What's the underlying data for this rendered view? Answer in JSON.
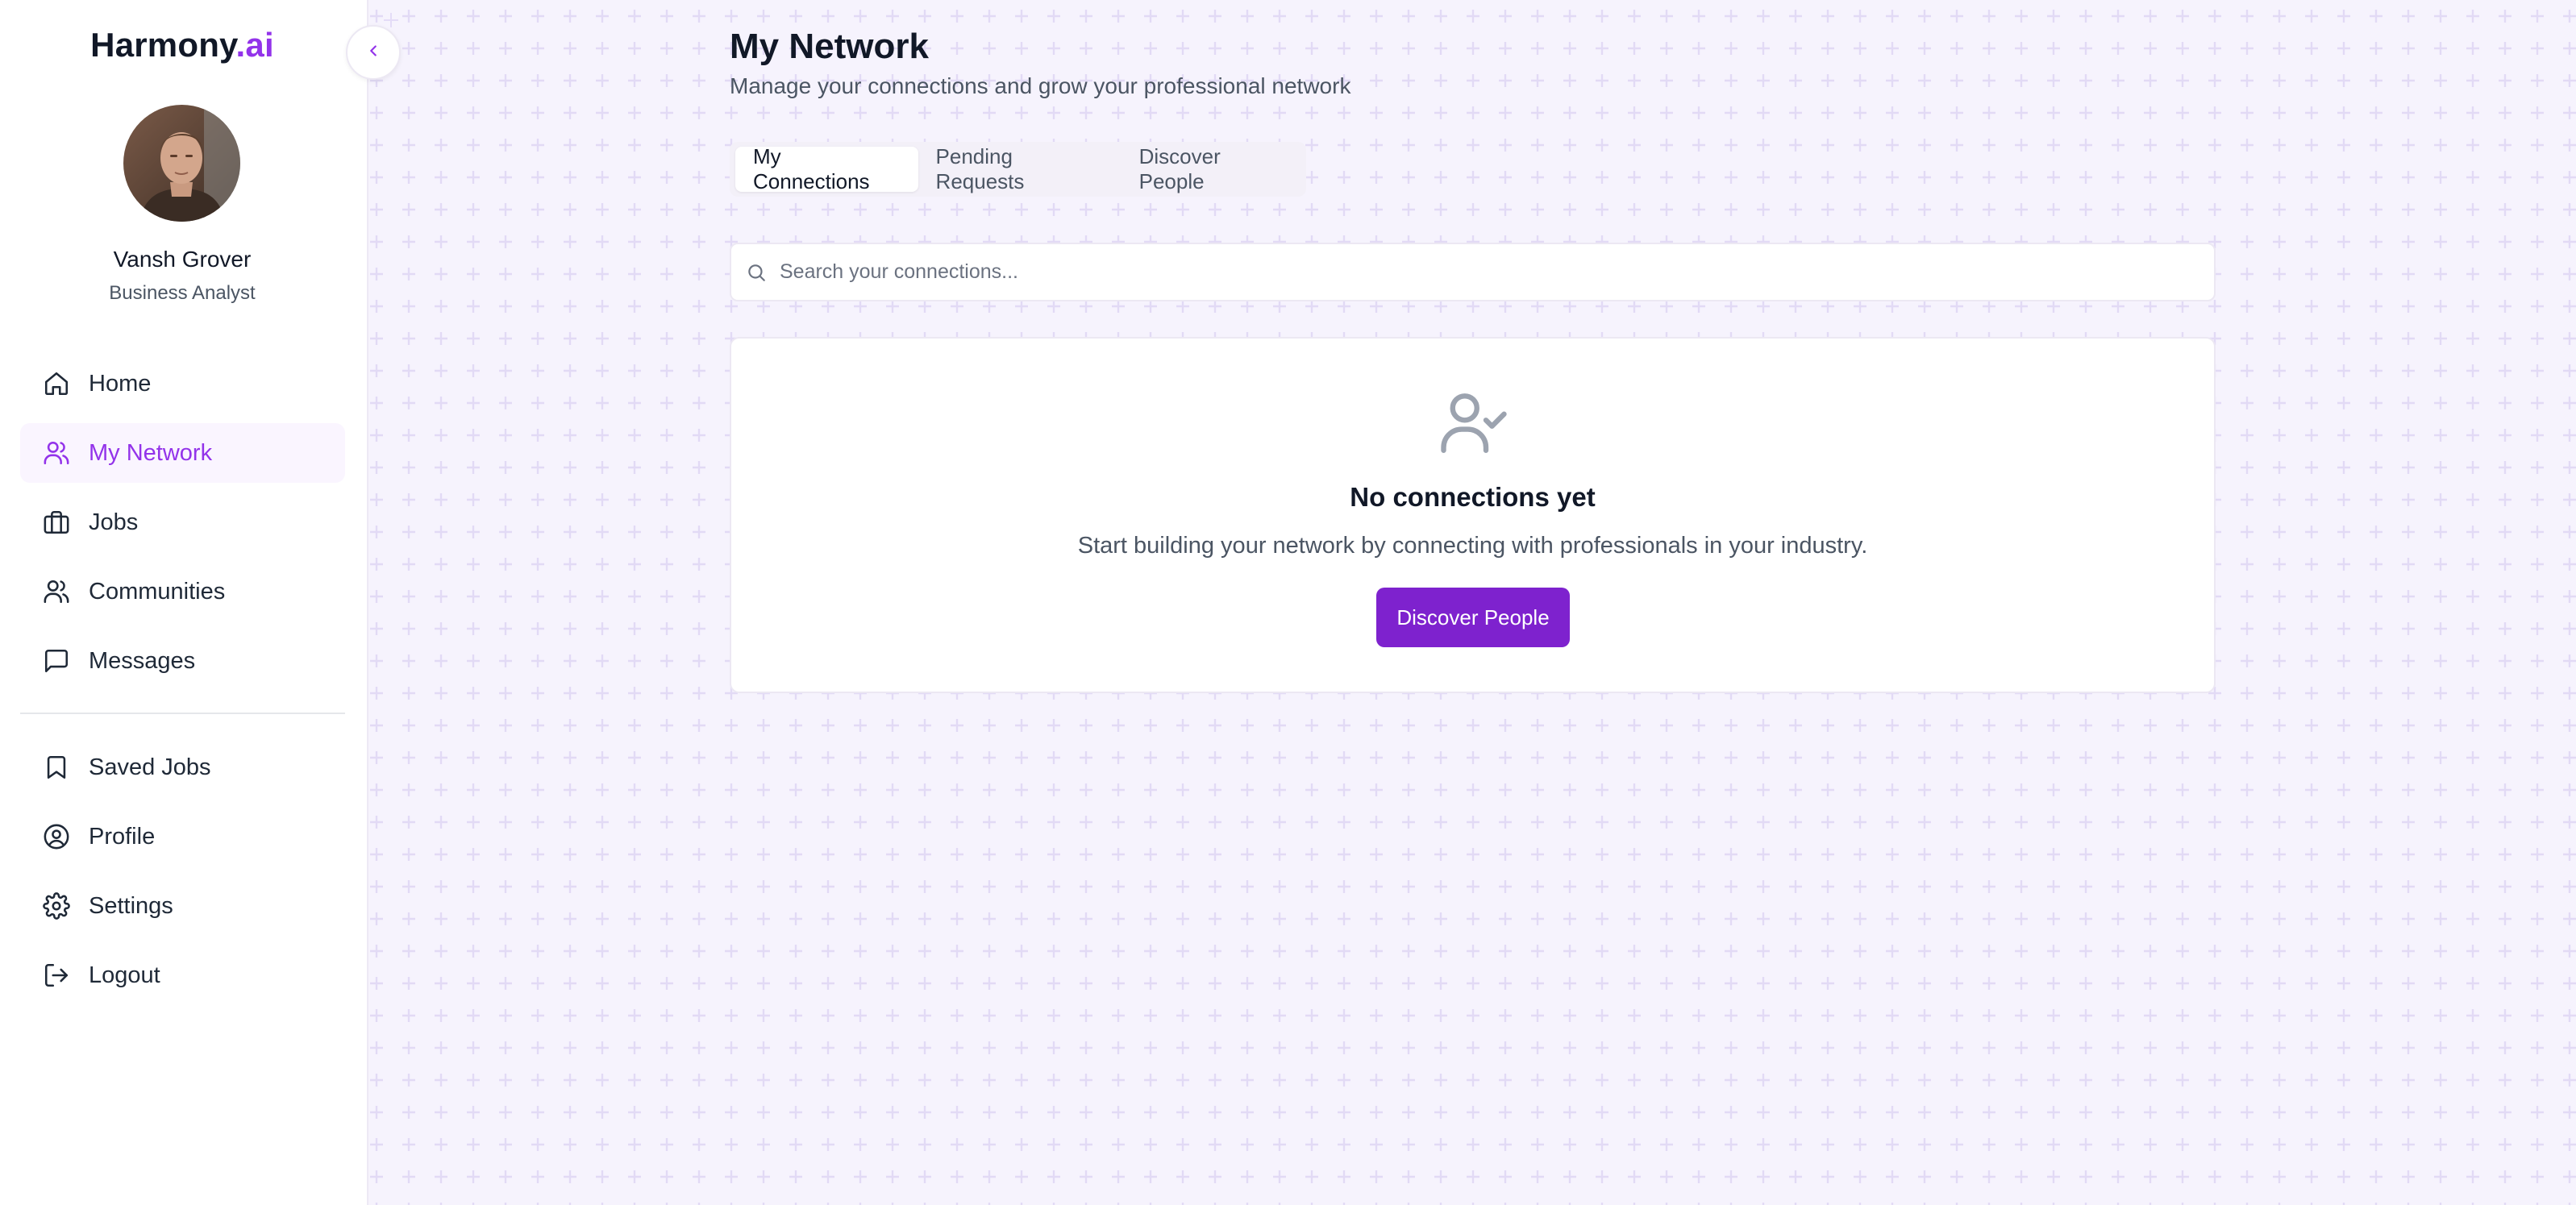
{
  "brand": {
    "name": "Harmony",
    "suffix": ".ai"
  },
  "user": {
    "name": "Vansh Grover",
    "role": "Business Analyst"
  },
  "sidebar": {
    "items": [
      {
        "label": "Home",
        "icon": "home-icon"
      },
      {
        "label": "My Network",
        "icon": "users-icon",
        "active": true
      },
      {
        "label": "Jobs",
        "icon": "briefcase-icon"
      },
      {
        "label": "Communities",
        "icon": "users-icon"
      },
      {
        "label": "Messages",
        "icon": "message-square-icon"
      },
      {
        "label": "Saved Jobs",
        "icon": "bookmark-icon"
      },
      {
        "label": "Profile",
        "icon": "user-circle-icon"
      },
      {
        "label": "Settings",
        "icon": "gear-icon"
      },
      {
        "label": "Logout",
        "icon": "logout-icon"
      }
    ]
  },
  "header": {
    "title": "My Network",
    "subtitle": "Manage your connections and grow your professional network"
  },
  "tabs": [
    {
      "label": "My Connections",
      "active": true
    },
    {
      "label": "Pending Requests"
    },
    {
      "label": "Discover People"
    }
  ],
  "search": {
    "placeholder": "Search your connections..."
  },
  "empty_state": {
    "icon": "user-check-icon",
    "title": "No connections yet",
    "description": "Start building your network by connecting with professionals in your industry.",
    "button_label": "Discover People"
  },
  "colors": {
    "accent": "#9333ea",
    "button": "#7e22ce",
    "background": "#f6f3fd"
  }
}
